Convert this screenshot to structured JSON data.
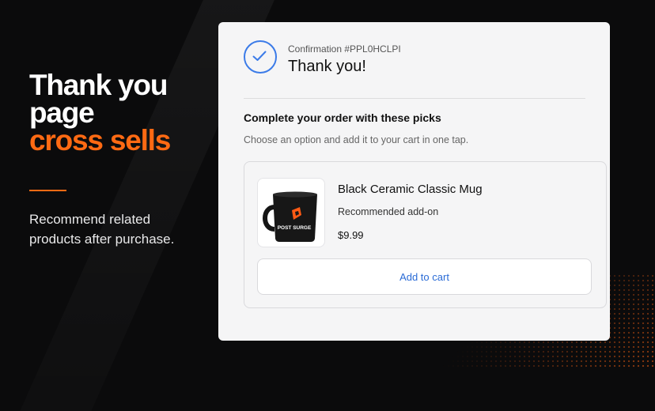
{
  "banner": {
    "headline_line1": "Thank you",
    "headline_line2": "page",
    "headline_accent": "cross sells",
    "subtitle": "Recommend related products after purchase."
  },
  "confirmation": {
    "label": "Confirmation #PPL0HCLPI",
    "title": "Thank you!",
    "icon": "check-circle-icon"
  },
  "cross_sell": {
    "title": "Complete your order with these picks",
    "subtitle": "Choose an option and add it to your cart in one tap."
  },
  "product": {
    "name": "Black Ceramic Classic Mug",
    "note": "Recommended add-on",
    "price": "$9.99",
    "image_text": "POST SURGE",
    "button_label": "Add to cart"
  },
  "colors": {
    "accent": "#ff6a13",
    "link_blue": "#2a6bd6",
    "check_blue": "#3b7be8",
    "background": "#0b0b0c",
    "card": "#f5f5f6"
  }
}
